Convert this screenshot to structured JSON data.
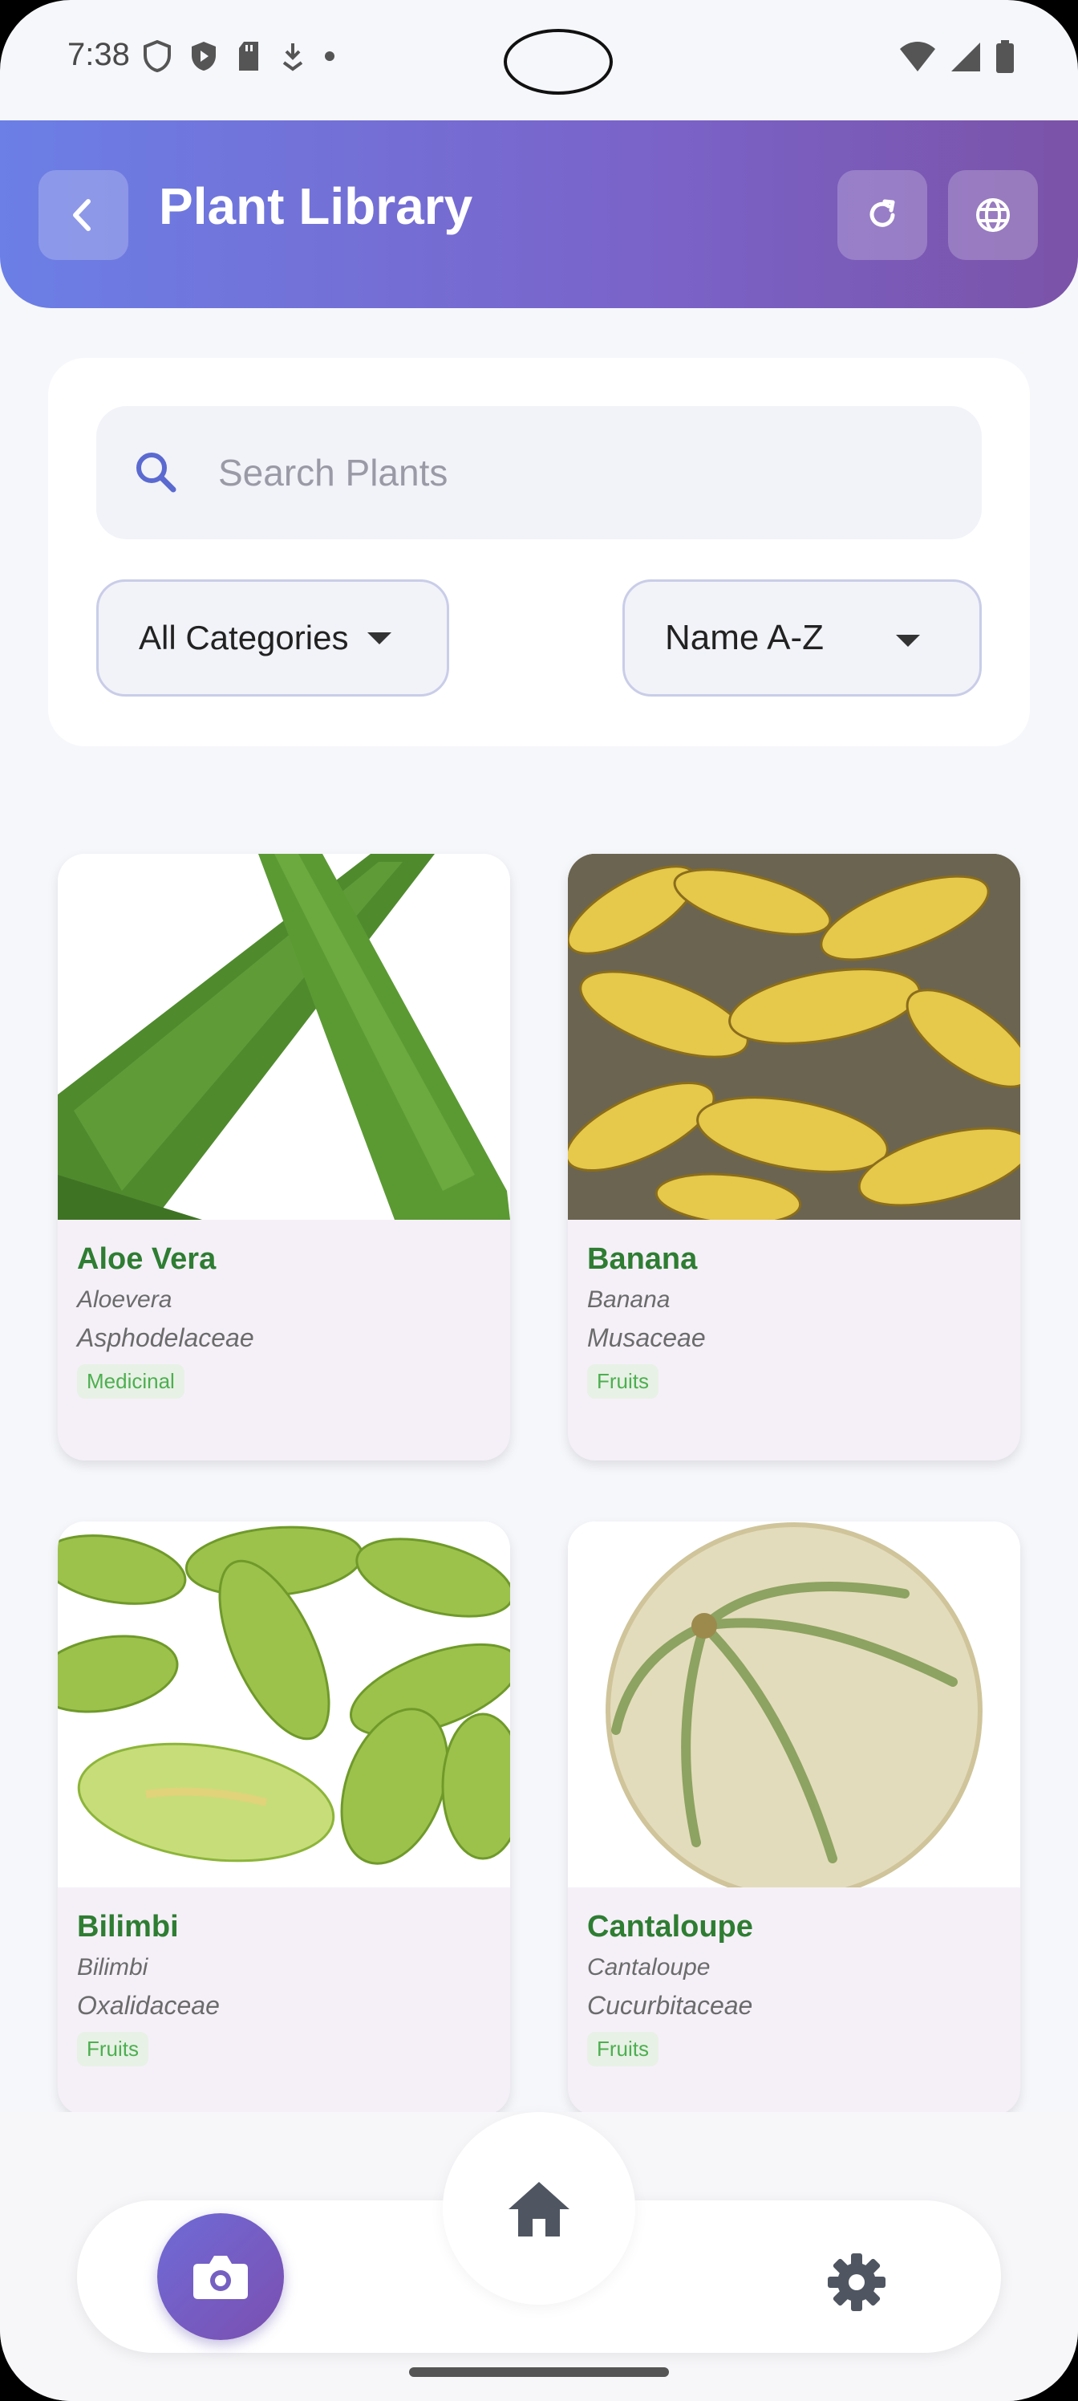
{
  "status_bar": {
    "time": "7:38",
    "left_icons": [
      "shield-icon",
      "play-shield-icon",
      "sd-card-icon",
      "download-icon",
      "dot-icon"
    ],
    "right_icons": [
      "wifi-icon",
      "signal-icon",
      "battery-icon"
    ]
  },
  "header": {
    "title": "Plant Library",
    "back_icon": "chevron-left-icon",
    "refresh_icon": "refresh-icon",
    "language_icon": "globe-icon",
    "gradient_start": "#6b7fe6",
    "gradient_end": "#7b53a8"
  },
  "filters": {
    "search_placeholder": "Search Plants",
    "search_value": "",
    "category_selected": "All Categories",
    "sort_selected": "Name A-Z"
  },
  "plants": [
    {
      "name": "Aloe Vera",
      "scientific": "Aloevera",
      "family": "Asphodelaceae",
      "category": "Medicinal"
    },
    {
      "name": "Banana",
      "scientific": "Banana",
      "family": "Musaceae",
      "category": "Fruits"
    },
    {
      "name": "Bilimbi",
      "scientific": "Bilimbi",
      "family": "Oxalidaceae",
      "category": "Fruits"
    },
    {
      "name": "Cantaloupe",
      "scientific": "Cantaloupe",
      "family": "Cucurbitaceae",
      "category": "Fruits"
    }
  ],
  "bottom_nav": {
    "camera_icon": "camera-icon",
    "home_icon": "home-icon",
    "settings_icon": "gear-icon"
  },
  "colors": {
    "accent": "#7a63c9",
    "plant_name": "#2e7d32",
    "badge_text": "#4caf50"
  }
}
